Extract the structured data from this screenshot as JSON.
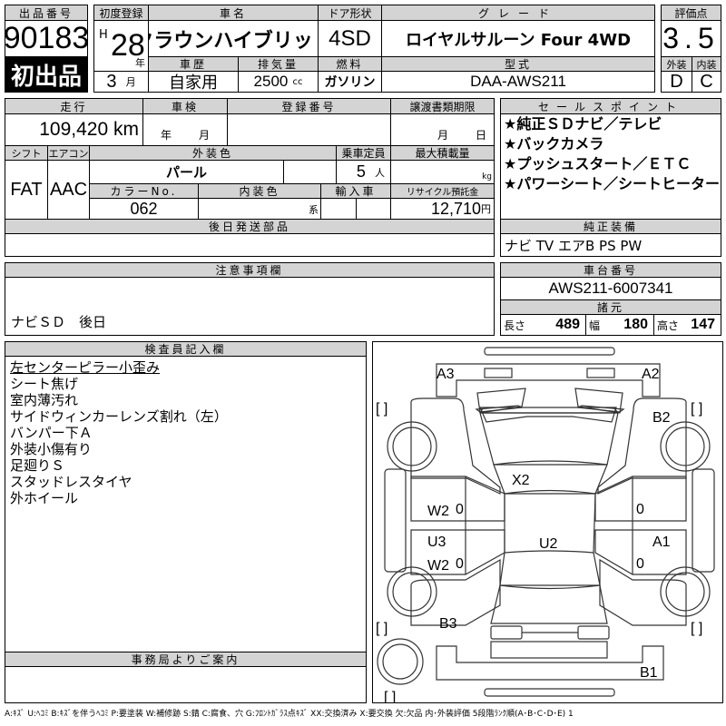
{
  "lot": {
    "label": "出品番号",
    "number": "90183",
    "badge": "初出品"
  },
  "reg": {
    "label": "初度登録",
    "era": "H",
    "year": "28",
    "year_unit": "年",
    "month": "3",
    "month_unit": "月"
  },
  "car_name": {
    "label": "車名",
    "value": "クラウンハイブリッド"
  },
  "door": {
    "label": "ドア形状",
    "value": "4SD"
  },
  "grade": {
    "label": "グレード",
    "value": "ロイヤルサルーン Four 4WD"
  },
  "history": {
    "label": "車歴",
    "value": "自家用"
  },
  "displacement": {
    "label": "排気量",
    "value": "2500",
    "unit": "cc"
  },
  "fuel": {
    "label": "燃料",
    "value": "ガソリン"
  },
  "model": {
    "label": "型式",
    "value": "DAA-AWS211"
  },
  "score": {
    "label": "評価点",
    "value": "3.5",
    "ext_label": "外装",
    "int_label": "内装",
    "ext": "D",
    "int": "C"
  },
  "mileage": {
    "label": "走行",
    "value": "109,420 km"
  },
  "inspection": {
    "label": "車検",
    "year_unit": "年",
    "month_unit": "月"
  },
  "plate": {
    "label": "登録番号"
  },
  "transfer": {
    "label": "譲渡書類期限",
    "month_unit": "月",
    "day_unit": "日"
  },
  "shift": {
    "label": "シフト",
    "value": "FAT"
  },
  "aircon": {
    "label": "エアコン",
    "value": "AAC"
  },
  "ext_color": {
    "label": "外装色",
    "value": "パール"
  },
  "capacity": {
    "label": "乗車定員",
    "value": "5",
    "unit": "人"
  },
  "max_load": {
    "label": "最大積載量",
    "unit": "kg"
  },
  "color_no": {
    "label": "カラーNo.",
    "value": "062"
  },
  "int_color": {
    "label": "内装色",
    "unit": "系"
  },
  "import": {
    "label": "輸入車"
  },
  "recycle": {
    "label": "リサイクル預託金",
    "value": "12,710",
    "unit": "円"
  },
  "later_parts": {
    "label": "後日発送部品"
  },
  "sales_points": {
    "label": "セールスポイント",
    "items": [
      "★純正ＳＤナビ／テレビ",
      "★バックカメラ",
      "★プッシュスタート／ＥＴＣ",
      "★パワーシート／シートヒーター"
    ]
  },
  "equipment": {
    "label": "純正装備",
    "value": "ナビ TV エアB PS PW"
  },
  "notes": {
    "label": "注意事項欄",
    "value": "ナビＳＤ　後日"
  },
  "chassis": {
    "label": "車台番号",
    "value": "AWS211-6007341"
  },
  "specs": {
    "label": "諸元",
    "length_label": "長さ",
    "length": "489",
    "width_label": "幅",
    "width": "180",
    "height_label": "高さ",
    "height": "147"
  },
  "inspector": {
    "label": "検査員記入欄",
    "lines": [
      "左センターピラー小歪み",
      "シート焦げ",
      "室内薄汚れ",
      "サイドウィンカーレンズ割れ（左）",
      "バンパー下Ａ",
      "外装小傷有り",
      "足廻りＳ",
      "スタッドレスタイヤ",
      "外ホイール"
    ]
  },
  "office": {
    "label": "事務局よりご案内"
  },
  "diagram": {
    "marks": {
      "a3": "A3",
      "a2": "A2",
      "b2": "B2",
      "x2": "X2",
      "w2_front": "W2",
      "u3": "U3",
      "u2": "U2",
      "a1": "A1",
      "w2_rear": "W2",
      "b3": "B3",
      "b1": "B1",
      "zero": "0",
      "bracket": "[    ]"
    }
  },
  "legend": "A:ｷｽﾞ U:ﾍｺﾐ B:ｷｽﾞを伴うﾍｺﾐ P:要塗装 W:補修跡 S:錆 C:腐食、穴 G:ﾌﾛﾝﾄｶﾞﾗｽ点ｷｽﾞ XX:交換済み X:要交換 欠:欠品 内･外装評価 5段階ﾗﾝｸ順(A･B･C･D･E) 1"
}
